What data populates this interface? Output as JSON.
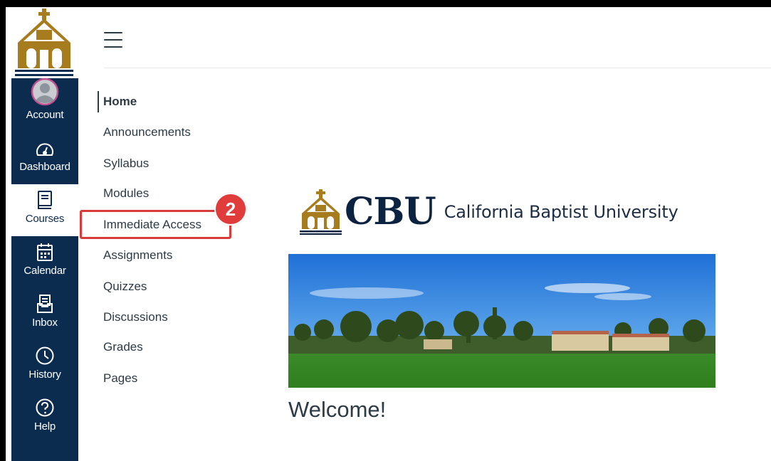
{
  "global_nav": {
    "logo_icon": "cbu-chapel-icon",
    "items": [
      {
        "id": "account",
        "label": "Account",
        "icon": "avatar-icon"
      },
      {
        "id": "dashboard",
        "label": "Dashboard",
        "icon": "speedometer-icon"
      },
      {
        "id": "courses",
        "label": "Courses",
        "icon": "book-icon",
        "active": true
      },
      {
        "id": "calendar",
        "label": "Calendar",
        "icon": "calendar-icon"
      },
      {
        "id": "inbox",
        "label": "Inbox",
        "icon": "inbox-icon"
      },
      {
        "id": "history",
        "label": "History",
        "icon": "clock-icon"
      },
      {
        "id": "help",
        "label": "Help",
        "icon": "question-icon"
      }
    ]
  },
  "course_nav": {
    "items": [
      {
        "label": "Home",
        "active": true
      },
      {
        "label": "Announcements"
      },
      {
        "label": "Syllabus"
      },
      {
        "label": "Modules"
      },
      {
        "label": "Immediate Access",
        "highlighted": true
      },
      {
        "label": "Assignments"
      },
      {
        "label": "Quizzes"
      },
      {
        "label": "Discussions"
      },
      {
        "label": "Grades"
      },
      {
        "label": "Pages"
      }
    ]
  },
  "annotation": {
    "step": "2",
    "color": "#e03c3c"
  },
  "main": {
    "logo_letters": "CBU",
    "university_name": "California Baptist University",
    "welcome": "Welcome!"
  },
  "colors": {
    "nav_bg": "#0b2c4f",
    "text": "#2d3b45",
    "brand_gold": "#a67c1e"
  }
}
